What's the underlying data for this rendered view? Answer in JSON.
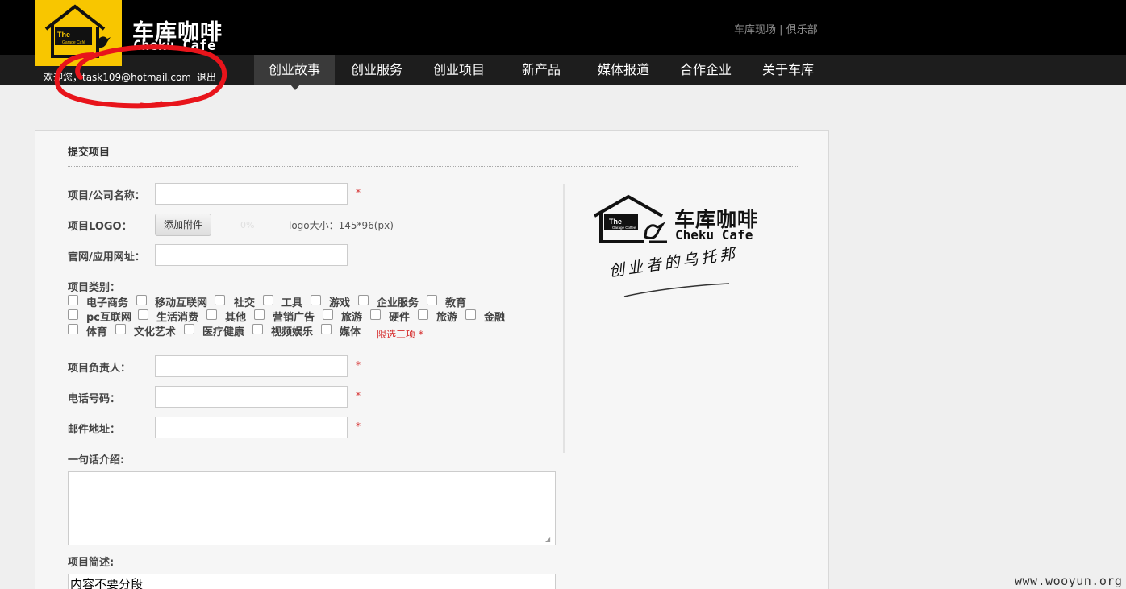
{
  "header": {
    "brand_cn": "车库咖啡",
    "brand_en": "Cheku Cafe",
    "logo_sign_text": "The",
    "logo_sign_sub": "Garage Café",
    "top_links": [
      "车库现场",
      "俱乐部"
    ],
    "top_links_separator": "|",
    "welcome": "欢迎您，task109@hotmail.com",
    "logout": "退出",
    "accent_color": "#f8c600"
  },
  "nav": {
    "items": [
      {
        "label": "创业故事",
        "active": true
      },
      {
        "label": "创业服务",
        "active": false
      },
      {
        "label": "创业项目",
        "active": false
      },
      {
        "label": "新产品",
        "active": false
      },
      {
        "label": "媒体报道",
        "active": false
      },
      {
        "label": "合作企业",
        "active": false
      },
      {
        "label": "关于车库",
        "active": false
      }
    ]
  },
  "form": {
    "title": "提交项目",
    "fields": {
      "name": {
        "label": "项目/公司名称：",
        "value": "",
        "required": "*"
      },
      "logo": {
        "label": "项目LOGO：",
        "button": "添加附件",
        "progress": "0%",
        "hint": "logo大小：145*96(px)"
      },
      "website": {
        "label": "官网/应用网址：",
        "value": ""
      },
      "owner": {
        "label": "项目负责人：",
        "value": "",
        "required": "*"
      },
      "phone": {
        "label": "电话号码：",
        "value": "",
        "required": "*"
      },
      "email": {
        "label": "邮件地址：",
        "value": "",
        "required": "*"
      },
      "oneliner": {
        "label": "一句话介绍:",
        "value": ""
      },
      "summary": {
        "label": "项目简述:",
        "value": "内容不要分段"
      }
    },
    "category": {
      "label": "项目类别：",
      "options": [
        "电子商务",
        "移动互联网",
        "社交",
        "工具",
        "游戏",
        "企业服务",
        "教育",
        "pc互联网",
        "生活消费",
        "其他",
        "营销广告",
        "旅游",
        "硬件",
        "旅游",
        "金融",
        "体育",
        "文化艺术",
        "医疗健康",
        "视频娱乐",
        "媒体"
      ],
      "limit": "限选三项 *"
    }
  },
  "side_logo": {
    "sign_text": "The",
    "sign_sub": "Garage Coffee",
    "brand_cn": "车库咖啡",
    "brand_en": "Cheku Cafe",
    "slogan": "创业者的乌托邦"
  },
  "watermark": "www.wooyun.org"
}
